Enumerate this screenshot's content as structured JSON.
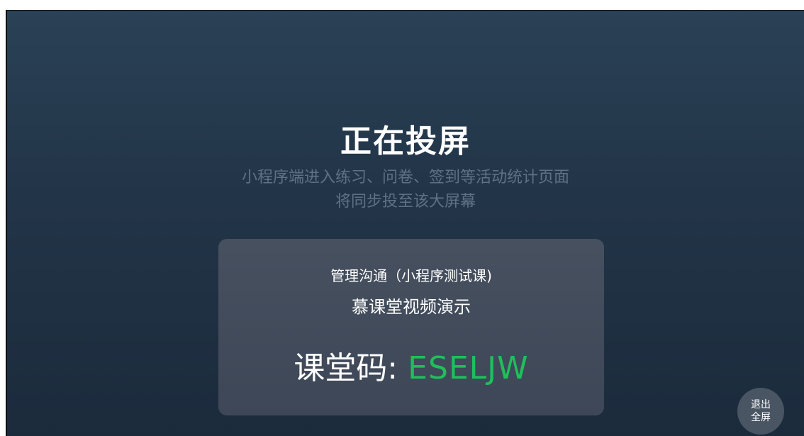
{
  "screen": {
    "title": "正在投屏",
    "subtitle_line1": "小程序端进入练习、问卷、签到等活动统计页面",
    "subtitle_line2": "将同步投至该大屏幕"
  },
  "card": {
    "course_name": "管理沟通（小程序测试课)",
    "video_name": "慕课堂视频演示",
    "code_label": "课堂码:",
    "code_value": "ESELJW"
  },
  "exit_button": {
    "line1": "退出",
    "line2": "全屏"
  },
  "colors": {
    "code_accent": "#1fbf5a",
    "background_top": "#2a4156",
    "background_bottom": "#1b2b3c",
    "card_bg": "#434d5c"
  }
}
